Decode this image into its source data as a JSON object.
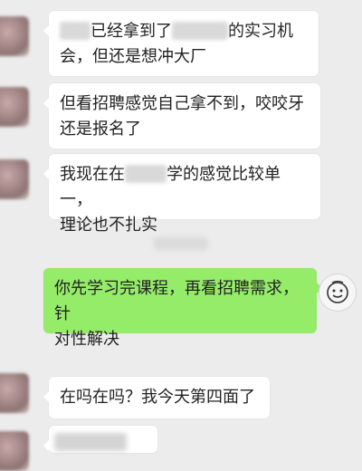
{
  "messages": [
    {
      "side": "left",
      "prefix": "",
      "redacted_1": "xx",
      "mid": "已经拿到了",
      "redacted_2": "xxxxxx",
      "line1_end": "的实习机",
      "line2": "会，但还是想冲大厂"
    },
    {
      "side": "left",
      "line1": "但看招聘感觉自己拿不到，咬咬牙",
      "line2": "还是报名了"
    },
    {
      "side": "left",
      "line1_start": "我现在在",
      "redacted": "xxx",
      "line1_end": "学的感觉比较单一，",
      "line2": "理论也不扎实"
    },
    {
      "side": "right",
      "line1": "你先学习完课程，再看招聘需求，针",
      "line2": "对性解决"
    },
    {
      "side": "left",
      "line1": "在吗在吗？我今天第四面了"
    }
  ],
  "colors": {
    "background": "#ececec",
    "bubble_left": "#ffffff",
    "bubble_right": "#95ec69"
  },
  "icons": {
    "self_avatar": "smiley-face-icon"
  }
}
